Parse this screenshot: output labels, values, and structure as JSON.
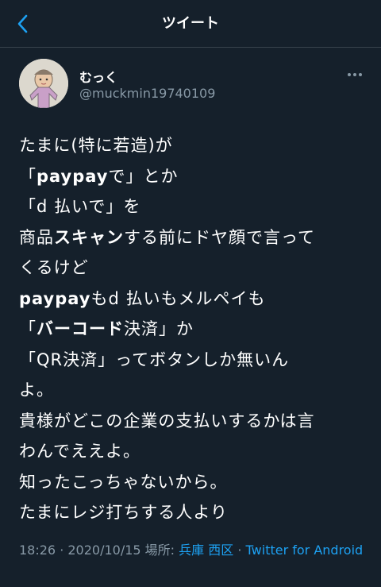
{
  "header": {
    "title": "ツイート",
    "back_icon": "chevron-left-icon",
    "accent_color": "#1da1f2"
  },
  "author": {
    "display_name": "むっく",
    "handle": "@muckmin19740109",
    "avatar_icon": "drawn-portrait-avatar",
    "more_icon": "more-dots-icon"
  },
  "tweet": {
    "lines": [
      [
        {
          "t": "たまに(特に若造)が"
        }
      ],
      [
        {
          "t": "「"
        },
        {
          "t": "paypay",
          "b": true
        },
        {
          "t": "で」とか"
        }
      ],
      [
        {
          "t": "「d 払いで」を"
        }
      ],
      [
        {
          "t": "商品"
        },
        {
          "t": "スキャン",
          "b": true
        },
        {
          "t": "する前にドヤ顔で言って"
        }
      ],
      [
        {
          "t": "くるけど"
        }
      ],
      [
        {
          "t": "paypay",
          "b": true
        },
        {
          "t": "もd 払いもメルペイも"
        }
      ],
      [
        {
          "t": "「"
        },
        {
          "t": "バーコード",
          "b": true
        },
        {
          "t": "決済」か"
        }
      ],
      [
        {
          "t": "「QR決済」ってボタンしか無いん"
        }
      ],
      [
        {
          "t": "よ。"
        }
      ],
      [
        {
          "t": "貴様がどこの企業の支払いするかは言"
        }
      ],
      [
        {
          "t": "わんでええよ。"
        }
      ],
      [
        {
          "t": "知ったこっちゃないから。"
        }
      ],
      [
        {
          "t": "たまにレジ打ちする人より"
        }
      ]
    ]
  },
  "meta": {
    "time": "18:26",
    "sep1": " · ",
    "date": "2020/10/15",
    "location_label": " 場所: ",
    "location": "兵庫 西区",
    "sep2": " · ",
    "source": "Twitter for Android"
  }
}
